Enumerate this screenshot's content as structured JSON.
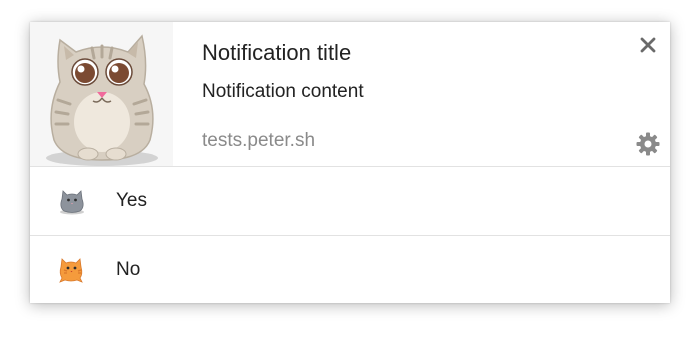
{
  "notification": {
    "title": "Notification title",
    "body": "Notification content",
    "origin": "tests.peter.sh",
    "image_icon": "cat-icon",
    "close_icon": "close-icon",
    "settings_icon": "gear-icon"
  },
  "actions": [
    {
      "label": "Yes",
      "icon": "gray-cat-icon"
    },
    {
      "label": "No",
      "icon": "orange-cat-icon"
    }
  ],
  "colors": {
    "origin_text": "#8a8a8a",
    "icon_gray": "#8a8a8a",
    "cat_body": "#d8cfc2",
    "cat_orange": "#f59b3c"
  }
}
